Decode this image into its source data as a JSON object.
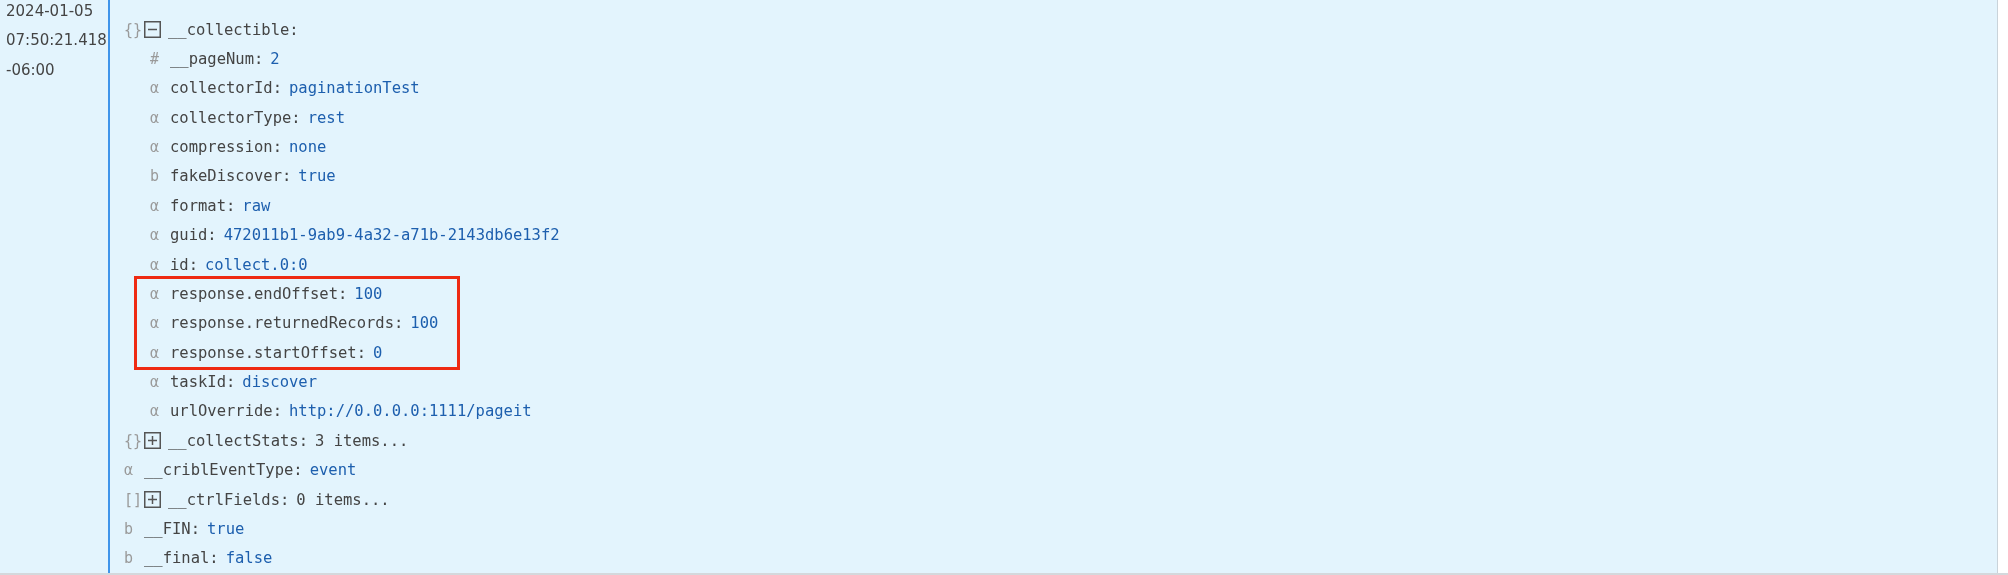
{
  "timestamp": [
    "2024-01-05",
    "07:50:21.418",
    "-06:00"
  ],
  "fields": [
    {
      "type": "{}",
      "key": "__collectible:",
      "expanded": true,
      "children": [
        {
          "type": "#",
          "key": "__pageNum:",
          "value": "2"
        },
        {
          "type": "α",
          "key": "collectorId:",
          "value": "paginationTest"
        },
        {
          "type": "α",
          "key": "collectorType:",
          "value": "rest"
        },
        {
          "type": "α",
          "key": "compression:",
          "value": "none"
        },
        {
          "type": "b",
          "key": "fakeDiscover:",
          "value": "true"
        },
        {
          "type": "α",
          "key": "format:",
          "value": "raw"
        },
        {
          "type": "α",
          "key": "guid:",
          "value": "472011b1-9ab9-4a32-a71b-2143db6e13f2"
        },
        {
          "type": "α",
          "key": "id:",
          "value": "collect.0:0"
        },
        {
          "type": "α",
          "key": "response.endOffset:",
          "value": "100",
          "highlighted": true
        },
        {
          "type": "α",
          "key": "response.returnedRecords:",
          "value": "100",
          "highlighted": true
        },
        {
          "type": "α",
          "key": "response.startOffset:",
          "value": "0",
          "highlighted": true
        },
        {
          "type": "α",
          "key": "taskId:",
          "value": "discover"
        },
        {
          "type": "α",
          "key": "urlOverride:",
          "value": "http://0.0.0.0:1111/pageit"
        }
      ]
    },
    {
      "type": "{}",
      "key": "__collectStats:",
      "expanded": false,
      "summary": "3 items..."
    },
    {
      "type": "α",
      "key": "__criblEventType:",
      "value": "event"
    },
    {
      "type": "[]",
      "key": "__ctrlFields:",
      "expanded": false,
      "summary": "0 items..."
    },
    {
      "type": "b",
      "key": "__FIN:",
      "value": "true"
    },
    {
      "type": "b",
      "key": "__final:",
      "value": "false"
    }
  ]
}
